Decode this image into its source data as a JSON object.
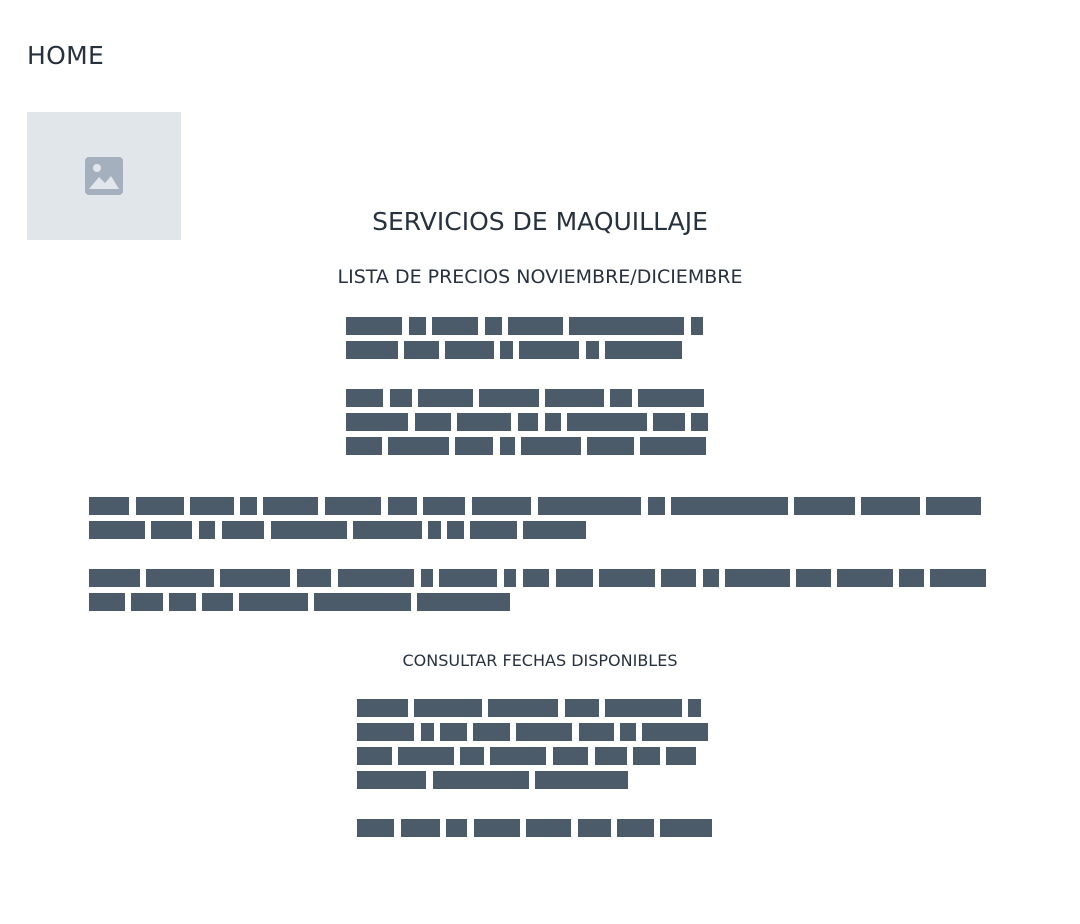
{
  "nav": {
    "home_label": "HOME"
  },
  "thumbnail": {
    "icon": "image-placeholder-icon",
    "background": "#e1e6eb",
    "icon_color": "#a4b0bd"
  },
  "content": {
    "title": "SERVICIOS DE MAQUILLAJE",
    "subtitle": "LISTA DE PRECIOS NOVIEMBRE/DICIEMBRE",
    "cta_label": "CONSULTAR FECHAS DISPONIBLES"
  },
  "colors": {
    "text": "#27323f",
    "redaction": "#4b5b6a",
    "background": "#ffffff"
  }
}
